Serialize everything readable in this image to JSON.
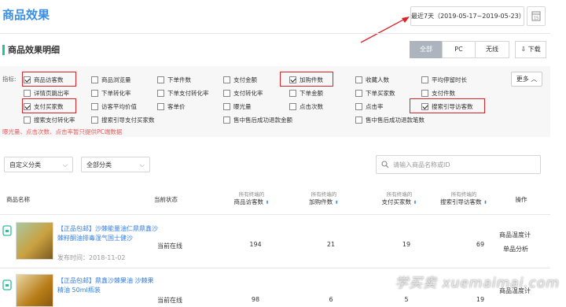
{
  "page": {
    "title": "商品效果"
  },
  "date_range": {
    "text": "最近7天（2019-05-17~2019-05-23）"
  },
  "section": {
    "title": "商品效果明细"
  },
  "segments": [
    "全部",
    "PC",
    "无线"
  ],
  "download": {
    "label": "下载"
  },
  "filter": {
    "label": "指标:",
    "more_label": "更多",
    "rows": [
      [
        {
          "label": "商品访客数",
          "checked": true
        },
        {
          "label": "商品浏览量",
          "checked": false
        },
        {
          "label": "下单件数",
          "checked": false
        },
        {
          "label": "支付金额",
          "checked": false
        },
        {
          "label": "加购件数",
          "checked": true
        },
        {
          "label": "收藏人数",
          "checked": false
        },
        {
          "label": "平均停留时长",
          "checked": false
        }
      ],
      [
        {
          "label": "详情页跳出率",
          "checked": false
        },
        {
          "label": "下单转化率",
          "checked": false
        },
        {
          "label": "下单支付转化率",
          "checked": false
        },
        {
          "label": "支付转化率",
          "checked": false
        },
        {
          "label": "下单金额",
          "checked": false
        },
        {
          "label": "下单买家数",
          "checked": false
        },
        {
          "label": "支付件数",
          "checked": false
        }
      ],
      [
        {
          "label": "支付买家数",
          "checked": true
        },
        {
          "label": "访客平均价值",
          "checked": false
        },
        {
          "label": "客单价",
          "checked": false
        },
        {
          "label": "曝光量",
          "checked": false
        },
        {
          "label": "点击次数",
          "checked": false
        },
        {
          "label": "点击率",
          "checked": false
        },
        {
          "label": "搜索引导访客数",
          "checked": true
        }
      ],
      [
        {
          "label": "搜索支付转化率",
          "checked": false
        },
        {
          "label": "搜索引导支付买家数",
          "checked": false
        },
        {
          "label": "售中售后成功退款金额",
          "checked": false
        },
        {
          "label": "售中售后成功退款笔数",
          "checked": false
        }
      ]
    ],
    "note": "曝光量、点击次数、点击率暂只提供PC端数据"
  },
  "dropdowns": [
    {
      "value": "自定义分类"
    },
    {
      "value": "全部分类"
    }
  ],
  "search": {
    "placeholder": "请输入商品名称或ID"
  },
  "table": {
    "headers": [
      {
        "label": "商品名称",
        "sub": ""
      },
      {
        "label": "当前状态",
        "sub": ""
      },
      {
        "label": "商品访客数",
        "sub": "所有终端的"
      },
      {
        "label": "加购件数",
        "sub": "所有终端的"
      },
      {
        "label": "支付买家数",
        "sub": "所有终端的"
      },
      {
        "label": "搜索引导访客数",
        "sub": "所有终端的"
      },
      {
        "label": "操作",
        "sub": ""
      }
    ],
    "rows": [
      {
        "name": "【正品包邮】沙棘能量油仁鼎鼎鑫沙棘籽酮油排毒湿气国士健沙",
        "published": "发布时间：2018-11-02",
        "status": "当前在线",
        "visitors": "194",
        "cart": "21",
        "buyers": "19",
        "search_visitors": "69",
        "actions": [
          "商品温度计",
          "单品分析"
        ]
      },
      {
        "name": "【正品包邮】鼎鑫沙棘果油 沙棘果精油 50ml瓶装",
        "published": "",
        "status": "当前在线",
        "visitors": "98",
        "cart": "6",
        "buyers": "5",
        "search_visitors": "19",
        "actions": [
          "商品温度计"
        ]
      }
    ]
  },
  "watermark": {
    "text": "学买卖 xuemaimai.com"
  }
}
